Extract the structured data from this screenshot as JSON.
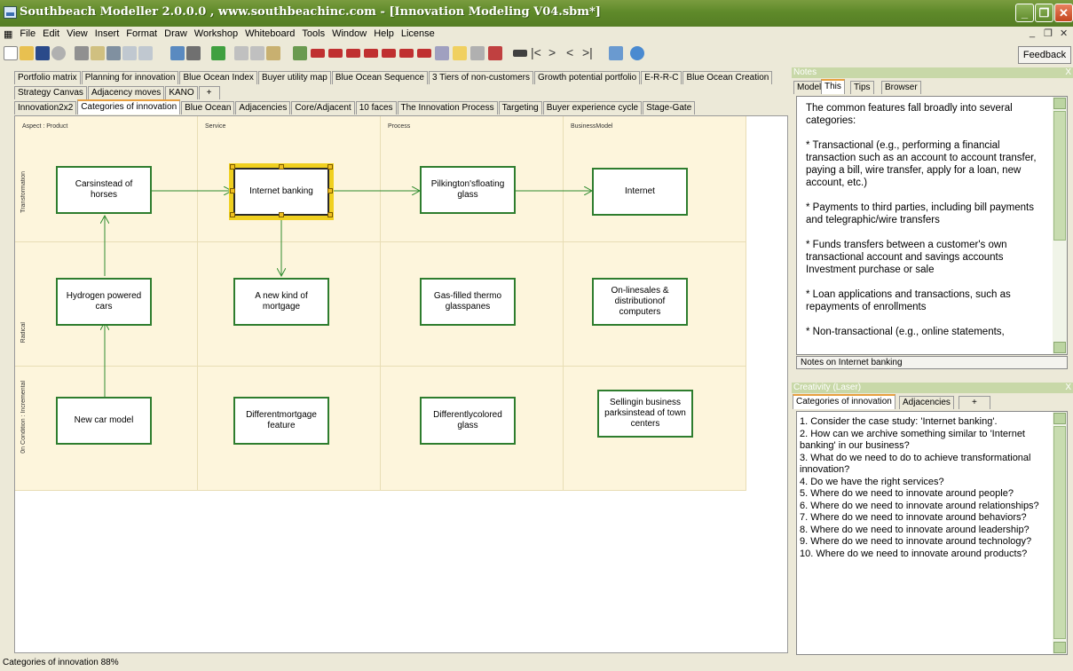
{
  "window": {
    "title": "Southbeach Modeller 2.0.0.0 , www.southbeachinc.com - [Innovation Modeling V04.sbm*]",
    "minimize": "_",
    "maximize": "❐",
    "close": "✕"
  },
  "menu": [
    "File",
    "Edit",
    "View",
    "Insert",
    "Format",
    "Draw",
    "Workshop",
    "Whiteboard",
    "Tools",
    "Window",
    "Help",
    "License"
  ],
  "mdi_controls": [
    "_",
    "❐",
    "✕"
  ],
  "toolbar": {
    "feedback_label": "Feedback"
  },
  "canvas_tabs_row1": [
    "Portfolio matrix",
    "Planning for innovation",
    "Blue Ocean Index",
    "Buyer utility map",
    "Blue Ocean Sequence",
    "3 Tiers of non-customers",
    "Growth potential portfolio",
    "E-R-R-C",
    "Blue Ocean Creation"
  ],
  "canvas_tabs_row2": [
    "Strategy Canvas",
    "Adjacency moves",
    "KANO",
    "+"
  ],
  "canvas_tabs_row3": [
    "Innovation2x2",
    "Categories of innovation",
    "Blue Ocean",
    "Adjacencies",
    "Core/Adjacent",
    "10 faces",
    "The Innovation Process",
    "Targeting",
    "Buyer experience cycle",
    "Stage-Gate"
  ],
  "active_canvas_tab": "Categories of innovation",
  "matrix": {
    "columns": [
      "Aspect : Product",
      "Service",
      "Process",
      "BusinessModel"
    ],
    "rows": [
      "Transformation",
      "Radical",
      "0n Condition : Incremental"
    ],
    "nodes": {
      "cars": "Carsinstead of horses",
      "internet_banking": "Internet banking",
      "pilkington": "Pilkington'sfloating glass",
      "internet": "Internet",
      "hydrogen": "Hydrogen powered cars",
      "mortgage": "A new kind of mortgage",
      "gas": "Gas-filled thermo glasspanes",
      "online_sales": "On-linesales & distributionof computers",
      "new_car": "New car model",
      "diff_mortgage": "Differentmortgage feature",
      "diff_glass": "Differentlycolored glass",
      "selling": "Sellingin business parksinstead of town centers"
    }
  },
  "notes_panel": {
    "header": "Notes",
    "tabs": [
      "Model",
      "This",
      "Tips",
      "Browser"
    ],
    "active_tab": "This",
    "paragraphs": [
      "The common features fall broadly into several categories:",
      "* Transactional (e.g., performing a financial transaction such as an account to account transfer, paying a bill, wire transfer, apply for a loan, new account, etc.)",
      "* Payments to third parties, including bill payments and telegraphic/wire transfers",
      "* Funds transfers between a customer's own transactional account and savings accounts Investment purchase or sale",
      "* Loan applications and transactions, such as repayments of enrollments",
      "* Non-transactional (e.g., online statements,"
    ],
    "footer": "Notes on Internet banking"
  },
  "creativity_panel": {
    "header": "Creativity (Laser)",
    "tabs": [
      "Categories of innovation",
      "Adjacencies",
      "+"
    ],
    "active_tab": "Categories of innovation",
    "items": [
      "1.  Consider the case study: 'Internet banking'.",
      "2.  How can we archive something similar to 'Internet banking' in our business?",
      "3.  What do we need to do to achieve transformational innovation?",
      "4.  Do we have the right services?",
      "5.  Where do we need to innovate around people?",
      "6.  Where do we need to innovate around relationships?",
      "7.  Where do we need to innovate around behaviors?",
      "8.  Where do we need to innovate around leadership?",
      "9.  Where do we need to innovate around technology?",
      "10. Where do we need to innovate around products?"
    ]
  },
  "status": {
    "text": "Categories of innovation  88%"
  }
}
